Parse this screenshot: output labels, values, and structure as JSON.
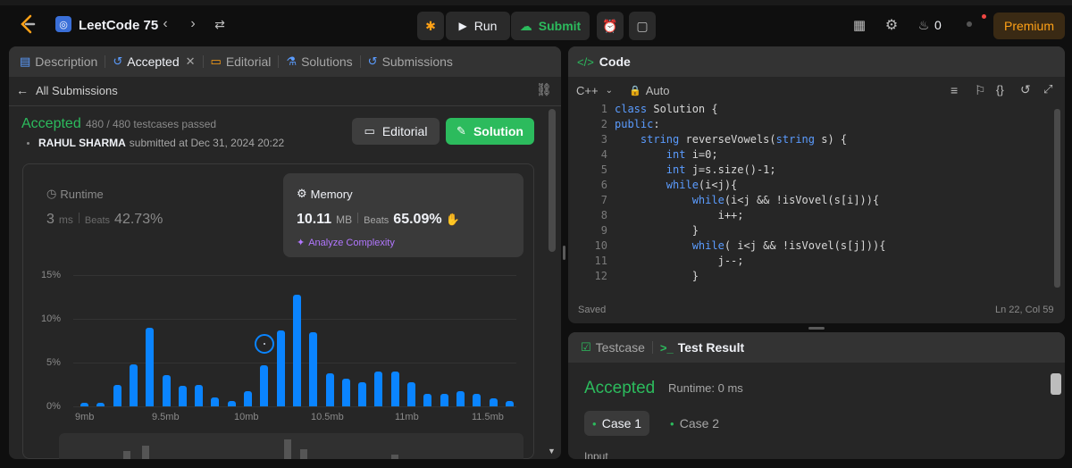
{
  "topbar": {
    "title": "LeetCode 75",
    "run_label": "Run",
    "submit_label": "Submit",
    "streak_count": "0",
    "premium_label": "Premium"
  },
  "left_panel": {
    "tabs": [
      {
        "label": "Description"
      },
      {
        "label": "Accepted"
      },
      {
        "label": "Editorial"
      },
      {
        "label": "Solutions"
      },
      {
        "label": "Submissions"
      }
    ],
    "back_label": "All Submissions",
    "status": "Accepted",
    "testcases": "480 / 480 testcases passed",
    "author": "RAHUL SHARMA",
    "submitted_text": "submitted at Dec 31, 2024 20:22",
    "editorial_btn": "Editorial",
    "solution_btn": "Solution",
    "runtime": {
      "label": "Runtime",
      "value": "3",
      "unit": "ms",
      "beats_label": "Beats",
      "beats": "42.73%"
    },
    "memory": {
      "label": "Memory",
      "value": "10.11",
      "unit": "MB",
      "beats_label": "Beats",
      "beats": "65.09%",
      "analyze": "Analyze Complexity"
    }
  },
  "chart_data": {
    "type": "bar",
    "ytick_labels": [
      "15%",
      "10%",
      "5%",
      "0%"
    ],
    "xtick_labels": [
      "9mb",
      "9.5mb",
      "10mb",
      "10.5mb",
      "11mb",
      "11.5mb"
    ],
    "ylim": [
      0,
      15
    ],
    "values": [
      0.4,
      0.4,
      2.5,
      4.8,
      9.0,
      3.6,
      2.3,
      2.4,
      1.0,
      0.6,
      1.7,
      4.7,
      8.7,
      12.8,
      8.5,
      3.8,
      3.2,
      2.8,
      4.0,
      4.0,
      2.8,
      1.4,
      1.4,
      1.7,
      1.4,
      0.9,
      0.6
    ],
    "highlight_index": 11
  },
  "code_panel": {
    "title": "Code",
    "language": "C++",
    "mode": "Auto",
    "saved": "Saved",
    "cursor": "Ln 22, Col 59",
    "lines": [
      {
        "n": "1",
        "text": "class Solution {"
      },
      {
        "n": "2",
        "text": "public:"
      },
      {
        "n": "3",
        "text": "    string reverseVowels(string s) {"
      },
      {
        "n": "4",
        "text": "        int i=0;"
      },
      {
        "n": "5",
        "text": "        int j=s.size()-1;"
      },
      {
        "n": "6",
        "text": "        while(i<j){"
      },
      {
        "n": "7",
        "text": "            while(i<j && !isVovel(s[i])){"
      },
      {
        "n": "8",
        "text": "                i++;"
      },
      {
        "n": "9",
        "text": "            }"
      },
      {
        "n": "10",
        "text": "            while( i<j && !isVovel(s[j])){"
      },
      {
        "n": "11",
        "text": "                j--;"
      },
      {
        "n": "12",
        "text": "            }"
      }
    ]
  },
  "result_panel": {
    "tab_testcase": "Testcase",
    "tab_result": "Test Result",
    "status": "Accepted",
    "runtime": "Runtime: 0 ms",
    "case1": "Case 1",
    "case2": "Case 2",
    "input_label": "Input"
  },
  "colors": {
    "green": "#2cbb5d",
    "accent": "#ffa116",
    "blue": "#0a84ff"
  }
}
